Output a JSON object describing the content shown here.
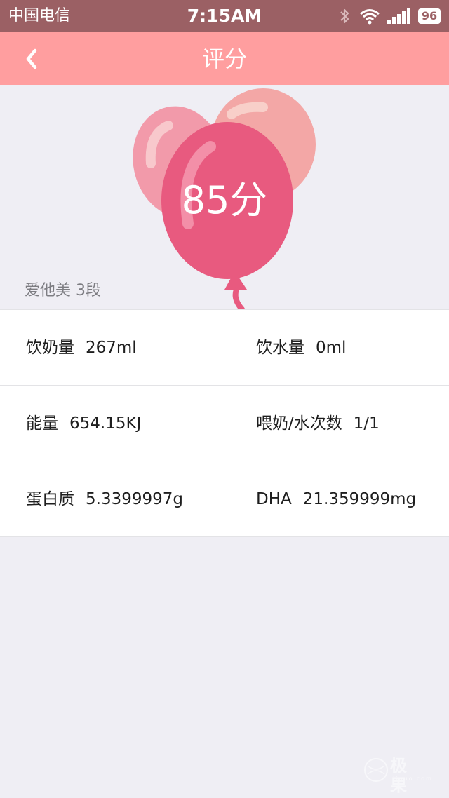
{
  "status_bar": {
    "carrier": "中国电信",
    "time": "7:15AM",
    "battery": "96"
  },
  "nav": {
    "title": "评分"
  },
  "hero": {
    "score": "85分",
    "product": "爱他美 3段",
    "colors": {
      "balloon_back_left": "#f29aaa",
      "balloon_back_right": "#f3a7a6",
      "balloon_front": "#e85a7f"
    }
  },
  "stats": [
    {
      "left_label": "饮奶量",
      "left_value": "267ml",
      "right_label": "饮水量",
      "right_value": "0ml"
    },
    {
      "left_label": "能量",
      "left_value": "654.15KJ",
      "right_label": "喂奶/水次数",
      "right_value": "1/1"
    },
    {
      "left_label": "蛋白质",
      "left_value": "5.3399997g",
      "right_label": "DHA",
      "right_value": "21.359999mg"
    }
  ],
  "watermark": {
    "text": "极果",
    "sub": "jiguo.com"
  }
}
